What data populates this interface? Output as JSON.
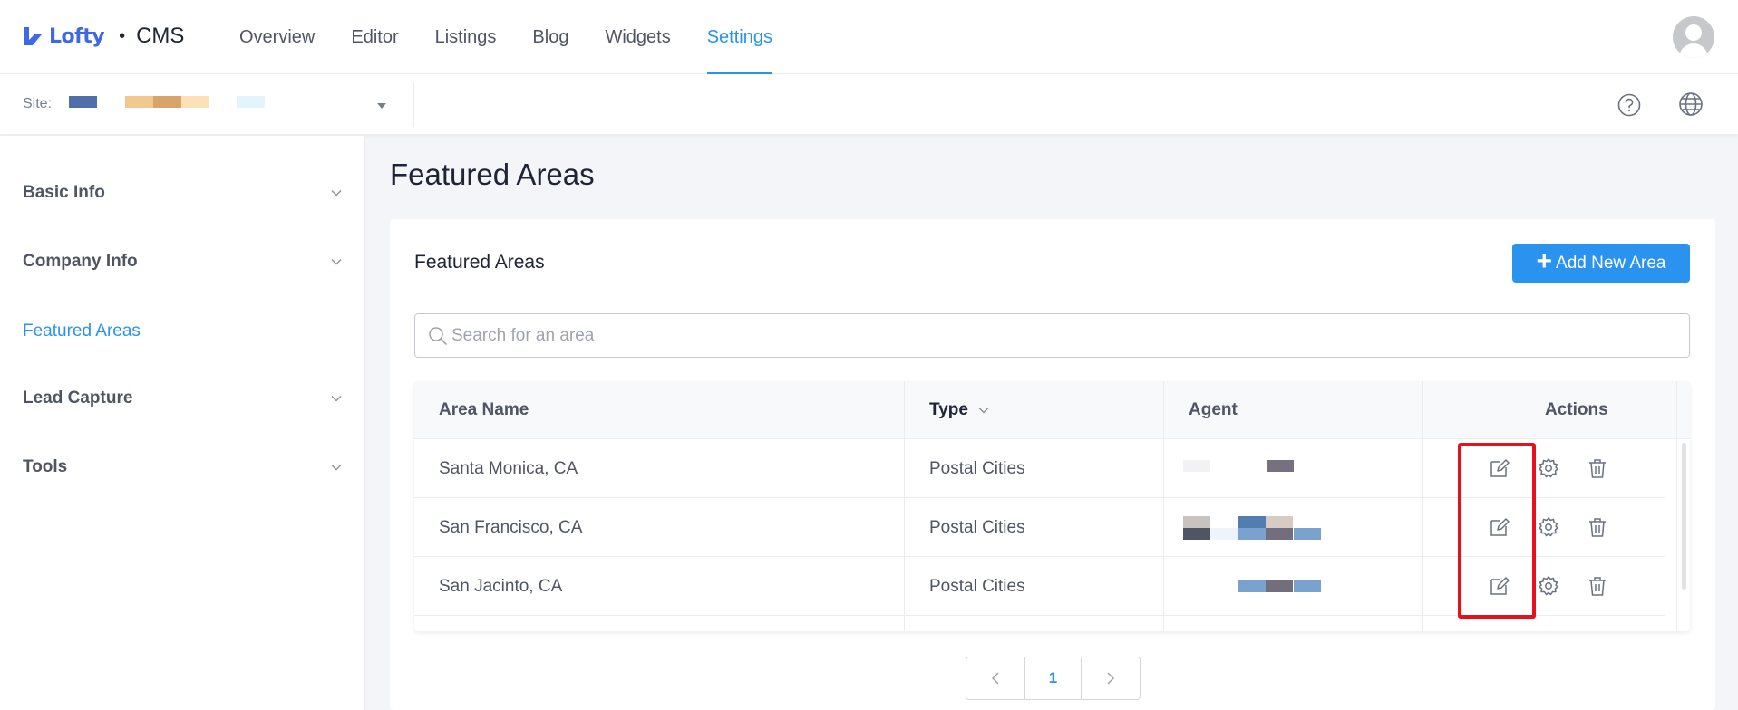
{
  "app": {
    "logo_text": "Lofty",
    "separator": "•",
    "product": "CMS"
  },
  "nav": {
    "items": [
      {
        "label": "Overview",
        "active": false
      },
      {
        "label": "Editor",
        "active": false
      },
      {
        "label": "Listings",
        "active": false
      },
      {
        "label": "Blog",
        "active": false
      },
      {
        "label": "Widgets",
        "active": false
      },
      {
        "label": "Settings",
        "active": true
      }
    ]
  },
  "sitebar": {
    "label": "Site:",
    "value_redacted": true
  },
  "sidebar": {
    "items": [
      {
        "label": "Basic Info",
        "expandable": true
      },
      {
        "label": "Company Info",
        "expandable": true
      },
      {
        "label": "Featured Areas",
        "active": true
      },
      {
        "label": "Lead Capture",
        "expandable": true
      },
      {
        "label": "Tools",
        "expandable": true
      }
    ]
  },
  "page": {
    "title": "Featured Areas"
  },
  "card": {
    "title": "Featured Areas",
    "add_button": "Add New Area",
    "search_placeholder": "Search for an area"
  },
  "table": {
    "headers": {
      "area_name": "Area Name",
      "type": "Type",
      "agent": "Agent",
      "actions": "Actions"
    },
    "rows": [
      {
        "area_name": "Santa Monica, CA",
        "type": "Postal Cities",
        "agent_redacted": true
      },
      {
        "area_name": "San Francisco, CA",
        "type": "Postal Cities",
        "agent_redacted": true
      },
      {
        "area_name": "San Jacinto, CA",
        "type": "Postal Cities",
        "agent_redacted": true
      }
    ]
  },
  "pagination": {
    "current_page": "1"
  },
  "colors": {
    "accent": "#2a93f0",
    "highlight": "#e8101a",
    "logo": "#3d68e8"
  }
}
